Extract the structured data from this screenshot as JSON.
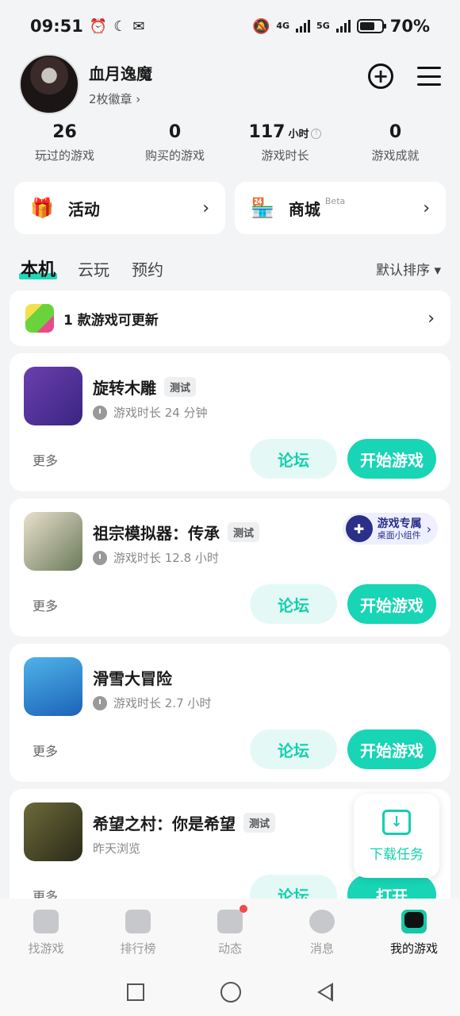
{
  "status_bar": {
    "time": "09:51",
    "net1": "4G",
    "net2": "5G",
    "battery": "70%",
    "battery_level": 0.7
  },
  "profile": {
    "username": "血月逸魔",
    "badges": "2枚徽章 ›"
  },
  "stats": [
    {
      "value": "26",
      "unit": "",
      "label": "玩过的游戏"
    },
    {
      "value": "0",
      "unit": "",
      "label": "购买的游戏"
    },
    {
      "value": "117",
      "unit": "小时",
      "label": "游戏时长"
    },
    {
      "value": "0",
      "unit": "",
      "label": "游戏成就"
    }
  ],
  "quick": {
    "activity": "活动",
    "mall": "商城",
    "mall_badge": "Beta"
  },
  "tabs": [
    "本机",
    "云玩",
    "预约"
  ],
  "sort_label": "默认排序 ▾",
  "update_banner": "1 款游戏可更新",
  "games": [
    {
      "name": "旋转木雕",
      "tag": "测试",
      "time": "游戏时长 24 分钟",
      "more": "更多",
      "forum": "论坛",
      "action": "开始游戏"
    },
    {
      "name": "祖宗模拟器：传承",
      "tag": "测试",
      "time": "游戏时长 12.8 小时",
      "more": "更多",
      "forum": "论坛",
      "action": "开始游戏",
      "widget_title": "游戏专属",
      "widget_sub": "桌面小组件"
    },
    {
      "name": "滑雪大冒险",
      "tag": "",
      "time": "游戏时长 2.7 小时",
      "more": "更多",
      "forum": "论坛",
      "action": "开始游戏"
    },
    {
      "name": "希望之村：你是希望",
      "tag": "测试",
      "time": "昨天浏览",
      "more": "更多",
      "forum": "论坛",
      "action": "打开"
    }
  ],
  "download_float": "下载任务",
  "bottom_nav": [
    "找游戏",
    "排行榜",
    "动态",
    "消息",
    "我的游戏"
  ],
  "colors": {
    "accent": "#17d5b5",
    "accent_light": "#e4f9f5",
    "notify": "#f24848"
  }
}
